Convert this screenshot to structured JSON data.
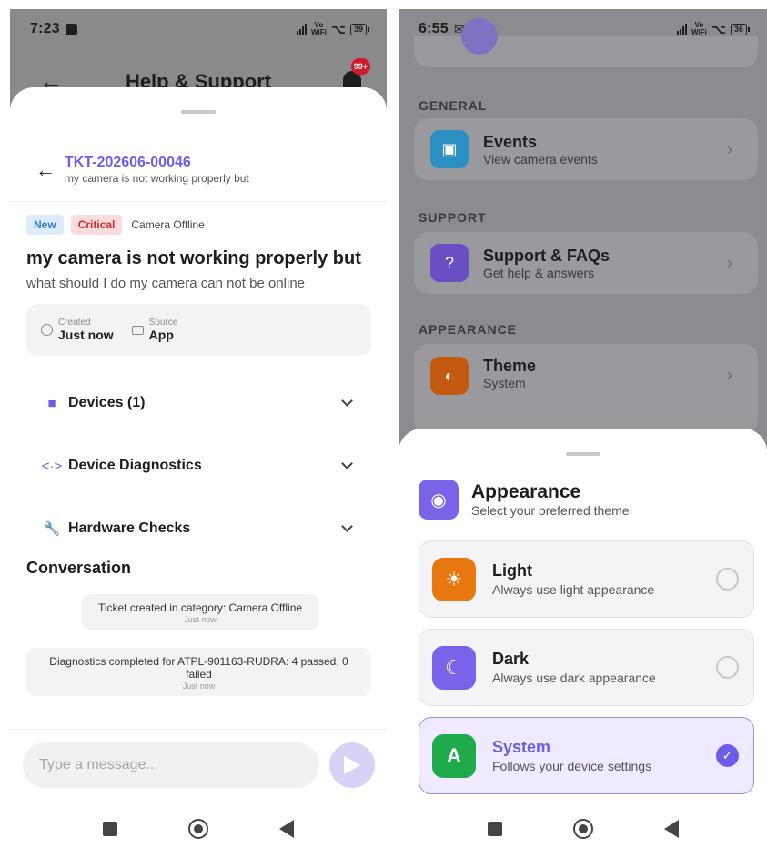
{
  "left": {
    "status": {
      "time": "7:23",
      "battery": "39"
    },
    "header": {
      "title": "Help & Support",
      "badge": "99+"
    },
    "ticket": {
      "id": "TKT-202606-00046",
      "subtitle": "my camera is not working properly but",
      "tags": {
        "new": "New",
        "critical": "Critical",
        "category": "Camera Offline"
      },
      "title": "my camera is not working properly but",
      "description": "what should I do my camera can not be online",
      "meta": {
        "created_label": "Created",
        "created_value": "Just now",
        "source_label": "Source",
        "source_value": "App"
      },
      "sections": [
        {
          "label": "Devices (1)",
          "icon": "video-icon"
        },
        {
          "label": "Device Diagnostics",
          "icon": "code-icon"
        },
        {
          "label": "Hardware Checks",
          "icon": "wrench-icon"
        }
      ]
    },
    "conversation": {
      "title": "Conversation",
      "messages": [
        {
          "text": "Ticket created in category: Camera Offline",
          "time": "Just now"
        },
        {
          "text": "Diagnostics completed for ATPL-901163-RUDRA: 4 passed, 0 failed",
          "time": "Just now"
        }
      ]
    },
    "composer": {
      "placeholder": "Type a message..."
    }
  },
  "right": {
    "status": {
      "time": "6:55",
      "battery": "36"
    },
    "sections": {
      "general": "GENERAL",
      "support": "SUPPORT",
      "appearance": "APPEARANCE"
    },
    "rows": {
      "events": {
        "title": "Events",
        "subtitle": "View camera events"
      },
      "support": {
        "title": "Support & FAQs",
        "subtitle": "Get help & answers"
      },
      "theme": {
        "title": "Theme",
        "subtitle": "System"
      }
    },
    "sheet": {
      "title": "Appearance",
      "subtitle": "Select your preferred theme",
      "options": [
        {
          "title": "Light",
          "subtitle": "Always use light appearance",
          "selected": false,
          "color": "#e8770f"
        },
        {
          "title": "Dark",
          "subtitle": "Always use dark appearance",
          "selected": false,
          "color": "#7a63e8"
        },
        {
          "title": "System",
          "subtitle": "Follows your device settings",
          "selected": true,
          "color": "#1faa4b"
        }
      ]
    }
  },
  "colors": {
    "accent": "#6c5ce7",
    "critical": "#d22b2b",
    "new": "#2f7ec9"
  }
}
